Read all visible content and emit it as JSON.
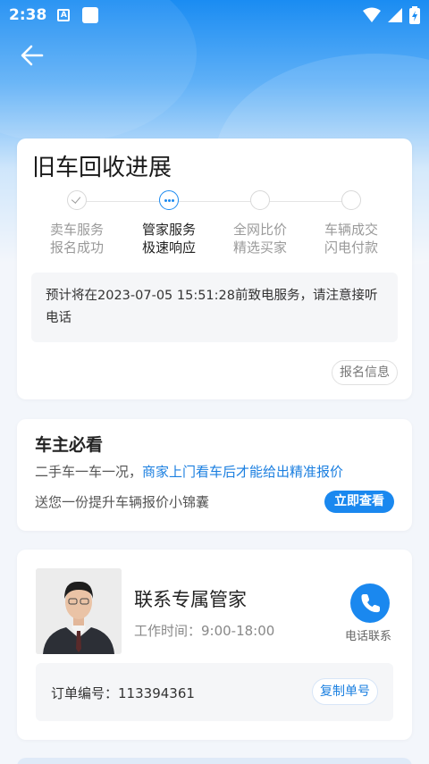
{
  "status_bar": {
    "time": "2:38",
    "note_icon_letter": "A"
  },
  "header": {
    "back_icon": "arrow-left-icon"
  },
  "progress": {
    "title": "旧车回收进展",
    "steps": [
      {
        "line1": "卖车服务",
        "line2": "报名成功",
        "state": "done"
      },
      {
        "line1": "管家服务",
        "line2": "极速响应",
        "state": "current"
      },
      {
        "line1": "全网比价",
        "line2": "精选买家",
        "state": "pending"
      },
      {
        "line1": "车辆成交",
        "line2": "闪电付款",
        "state": "pending"
      }
    ],
    "notice": "预计将在2023-07-05 15:51:28前致电服务，请注意接听电话",
    "signup_info_label": "报名信息"
  },
  "owner_tips": {
    "title": "车主必看",
    "text_plain": "二手车一车一况，",
    "text_highlight": "商家上门看车后才能给出精准报价",
    "text2": "送您一份提升车辆报价小锦囊",
    "view_button": "立即查看"
  },
  "butler": {
    "name": "联系专属管家",
    "work_time": "工作时间：9:00-18:00",
    "call_label": "电话联系",
    "order_label": "订单编号：",
    "order_number": "113394361",
    "copy_button": "复制单号"
  },
  "colors": {
    "accent": "#1a88ef",
    "highlight_text": "#1b7fe0"
  }
}
